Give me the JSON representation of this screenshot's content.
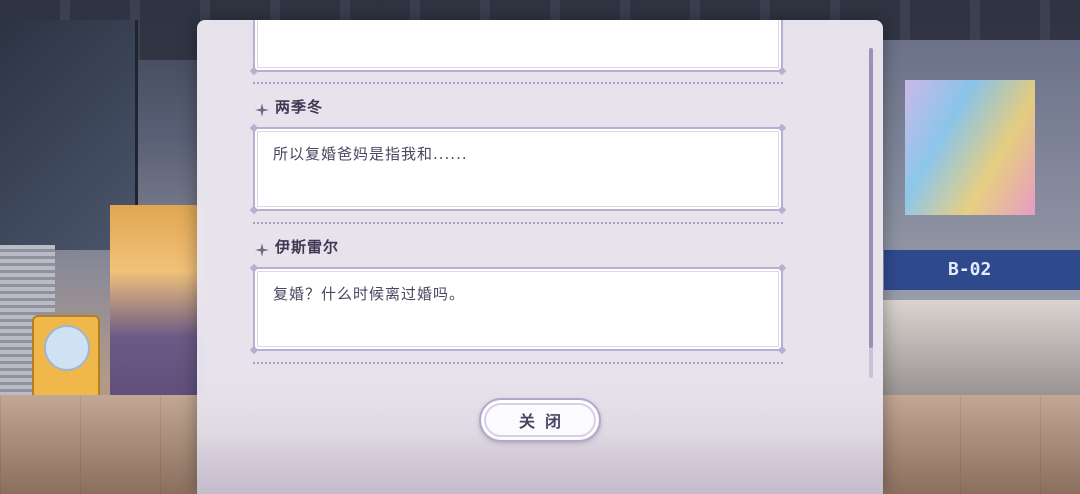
{
  "background": {
    "sign_label": "B-02"
  },
  "dialog": {
    "messages": [
      {
        "speaker": "",
        "text": ""
      },
      {
        "speaker": "两季冬",
        "text": "所以复婚爸妈是指我和......"
      },
      {
        "speaker": "伊斯雷尔",
        "text": "复婚？什么时候离过婚吗。"
      }
    ],
    "close_label": "关闭"
  },
  "colors": {
    "accent": "#b8aed0",
    "panel": "#ece8f1",
    "text": "#4b4560"
  },
  "icons": {
    "speaker_marker": "sparkle-icon"
  }
}
